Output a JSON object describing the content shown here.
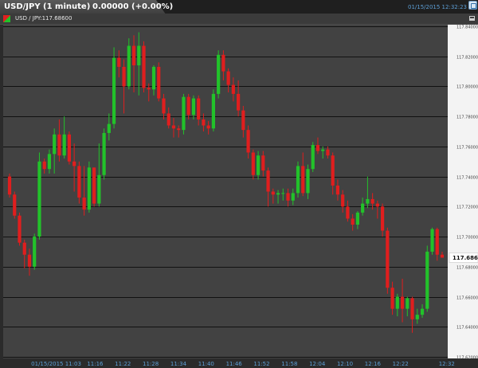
{
  "header": {
    "title": "USD/JPY (1 minute)",
    "change": "0.00000 (+0.00%)",
    "datetime": "01/15/2015 12:32:23"
  },
  "subheader": {
    "symbol_label": "USD / JPY:117.68600"
  },
  "colors": {
    "up": "#22c22a",
    "down": "#e01e1e",
    "background": "#424242",
    "grid": "#111111",
    "axis_text": "#5d9fd6"
  },
  "chart_data": {
    "type": "candlestick",
    "y_ticks": [
      "117.84000",
      "117.82000",
      "117.80000",
      "117.78000",
      "117.76000",
      "117.74000",
      "117.72000",
      "117.70000",
      "117.68000",
      "117.66000",
      "117.64000",
      "117.62000"
    ],
    "ylim": [
      117.62,
      117.84
    ],
    "x_ticks": [
      {
        "label": "01/15/2015 11:03",
        "x": 11.05
      },
      {
        "label": "11:16",
        "x": 11.2667
      },
      {
        "label": "11:22",
        "x": 11.3667
      },
      {
        "label": "11:28",
        "x": 11.4667
      },
      {
        "label": "11:34",
        "x": 11.5667
      },
      {
        "label": "11:40",
        "x": 11.6667
      },
      {
        "label": "11:46",
        "x": 11.7667
      },
      {
        "label": "11:52",
        "x": 11.8667
      },
      {
        "label": "11:58",
        "x": 11.9667
      },
      {
        "label": "12:04",
        "x": 12.0667
      },
      {
        "label": "12:10",
        "x": 12.1667
      },
      {
        "label": "12:16",
        "x": 12.2667
      },
      {
        "label": "12:22",
        "x": 12.3667
      },
      {
        "label": "12:32",
        "x": 12.5333
      }
    ],
    "last_price": "117.68600",
    "grid": true,
    "candles": [
      {
        "o": 117.74,
        "h": 117.742,
        "l": 117.726,
        "c": 117.728
      },
      {
        "o": 117.728,
        "h": 117.73,
        "l": 117.712,
        "c": 117.714
      },
      {
        "o": 117.714,
        "h": 117.716,
        "l": 117.694,
        "c": 117.696
      },
      {
        "o": 117.696,
        "h": 117.698,
        "l": 117.679,
        "c": 117.688
      },
      {
        "o": 117.688,
        "h": 117.692,
        "l": 117.674,
        "c": 117.68
      },
      {
        "o": 117.68,
        "h": 117.702,
        "l": 117.678,
        "c": 117.7
      },
      {
        "o": 117.7,
        "h": 117.756,
        "l": 117.698,
        "c": 117.75
      },
      {
        "o": 117.75,
        "h": 117.752,
        "l": 117.742,
        "c": 117.745
      },
      {
        "o": 117.745,
        "h": 117.758,
        "l": 117.742,
        "c": 117.755
      },
      {
        "o": 117.755,
        "h": 117.772,
        "l": 117.742,
        "c": 117.768
      },
      {
        "o": 117.768,
        "h": 117.778,
        "l": 117.75,
        "c": 117.754
      },
      {
        "o": 117.754,
        "h": 117.78,
        "l": 117.752,
        "c": 117.768
      },
      {
        "o": 117.768,
        "h": 117.77,
        "l": 117.748,
        "c": 117.75
      },
      {
        "o": 117.75,
        "h": 117.762,
        "l": 117.73,
        "c": 117.747
      },
      {
        "o": 117.747,
        "h": 117.75,
        "l": 117.722,
        "c": 117.726
      },
      {
        "o": 117.726,
        "h": 117.747,
        "l": 117.714,
        "c": 117.718
      },
      {
        "o": 117.718,
        "h": 117.75,
        "l": 117.716,
        "c": 117.746
      },
      {
        "o": 117.746,
        "h": 117.746,
        "l": 117.72,
        "c": 117.722
      },
      {
        "o": 117.722,
        "h": 117.762,
        "l": 117.72,
        "c": 117.741
      },
      {
        "o": 117.741,
        "h": 117.772,
        "l": 117.738,
        "c": 117.769
      },
      {
        "o": 117.769,
        "h": 117.782,
        "l": 117.764,
        "c": 117.775
      },
      {
        "o": 117.775,
        "h": 117.826,
        "l": 117.772,
        "c": 117.819
      },
      {
        "o": 117.819,
        "h": 117.824,
        "l": 117.806,
        "c": 117.813
      },
      {
        "o": 117.813,
        "h": 117.818,
        "l": 117.782,
        "c": 117.8
      },
      {
        "o": 117.8,
        "h": 117.832,
        "l": 117.798,
        "c": 117.827
      },
      {
        "o": 117.827,
        "h": 117.834,
        "l": 117.796,
        "c": 117.814
      },
      {
        "o": 117.814,
        "h": 117.836,
        "l": 117.794,
        "c": 117.827
      },
      {
        "o": 117.827,
        "h": 117.83,
        "l": 117.796,
        "c": 117.799
      },
      {
        "o": 117.799,
        "h": 117.802,
        "l": 117.79,
        "c": 117.798
      },
      {
        "o": 117.798,
        "h": 117.814,
        "l": 117.794,
        "c": 117.813
      },
      {
        "o": 117.813,
        "h": 117.816,
        "l": 117.79,
        "c": 117.792
      },
      {
        "o": 117.792,
        "h": 117.795,
        "l": 117.778,
        "c": 117.782
      },
      {
        "o": 117.782,
        "h": 117.786,
        "l": 117.772,
        "c": 117.774
      },
      {
        "o": 117.774,
        "h": 117.779,
        "l": 117.766,
        "c": 117.772
      },
      {
        "o": 117.772,
        "h": 117.774,
        "l": 117.766,
        "c": 117.771
      },
      {
        "o": 117.771,
        "h": 117.795,
        "l": 117.768,
        "c": 117.793
      },
      {
        "o": 117.793,
        "h": 117.795,
        "l": 117.778,
        "c": 117.781
      },
      {
        "o": 117.781,
        "h": 117.794,
        "l": 117.778,
        "c": 117.792
      },
      {
        "o": 117.792,
        "h": 117.794,
        "l": 117.774,
        "c": 117.778
      },
      {
        "o": 117.778,
        "h": 117.782,
        "l": 117.77,
        "c": 117.774
      },
      {
        "o": 117.774,
        "h": 117.777,
        "l": 117.768,
        "c": 117.772
      },
      {
        "o": 117.772,
        "h": 117.798,
        "l": 117.77,
        "c": 117.795
      },
      {
        "o": 117.795,
        "h": 117.824,
        "l": 117.792,
        "c": 117.821
      },
      {
        "o": 117.821,
        "h": 117.824,
        "l": 117.804,
        "c": 117.81
      },
      {
        "o": 117.81,
        "h": 117.812,
        "l": 117.796,
        "c": 117.801
      },
      {
        "o": 117.801,
        "h": 117.806,
        "l": 117.79,
        "c": 117.795
      },
      {
        "o": 117.795,
        "h": 117.804,
        "l": 117.78,
        "c": 117.784
      },
      {
        "o": 117.784,
        "h": 117.787,
        "l": 117.766,
        "c": 117.771
      },
      {
        "o": 117.771,
        "h": 117.774,
        "l": 117.752,
        "c": 117.756
      },
      {
        "o": 117.756,
        "h": 117.758,
        "l": 117.738,
        "c": 117.741
      },
      {
        "o": 117.741,
        "h": 117.757,
        "l": 117.738,
        "c": 117.754
      },
      {
        "o": 117.754,
        "h": 117.757,
        "l": 117.74,
        "c": 117.744
      },
      {
        "o": 117.744,
        "h": 117.746,
        "l": 117.72,
        "c": 117.73
      },
      {
        "o": 117.73,
        "h": 117.732,
        "l": 117.722,
        "c": 117.728
      },
      {
        "o": 117.728,
        "h": 117.731,
        "l": 117.722,
        "c": 117.729
      },
      {
        "o": 117.729,
        "h": 117.732,
        "l": 117.724,
        "c": 117.729
      },
      {
        "o": 117.729,
        "h": 117.732,
        "l": 117.72,
        "c": 117.724
      },
      {
        "o": 117.724,
        "h": 117.732,
        "l": 117.721,
        "c": 117.729
      },
      {
        "o": 117.729,
        "h": 117.75,
        "l": 117.726,
        "c": 117.747
      },
      {
        "o": 117.747,
        "h": 117.756,
        "l": 117.727,
        "c": 117.729
      },
      {
        "o": 117.729,
        "h": 117.748,
        "l": 117.725,
        "c": 117.745
      },
      {
        "o": 117.745,
        "h": 117.763,
        "l": 117.743,
        "c": 117.761
      },
      {
        "o": 117.761,
        "h": 117.766,
        "l": 117.755,
        "c": 117.757
      },
      {
        "o": 117.757,
        "h": 117.76,
        "l": 117.752,
        "c": 117.758
      },
      {
        "o": 117.758,
        "h": 117.76,
        "l": 117.752,
        "c": 117.754
      },
      {
        "o": 117.754,
        "h": 117.756,
        "l": 117.728,
        "c": 117.734
      },
      {
        "o": 117.734,
        "h": 117.738,
        "l": 117.724,
        "c": 117.728
      },
      {
        "o": 117.728,
        "h": 117.731,
        "l": 117.716,
        "c": 117.72
      },
      {
        "o": 117.72,
        "h": 117.724,
        "l": 117.71,
        "c": 117.712
      },
      {
        "o": 117.712,
        "h": 117.715,
        "l": 117.704,
        "c": 117.708
      },
      {
        "o": 117.708,
        "h": 117.717,
        "l": 117.705,
        "c": 117.716
      },
      {
        "o": 117.716,
        "h": 117.726,
        "l": 117.714,
        "c": 117.722
      },
      {
        "o": 117.722,
        "h": 117.74,
        "l": 117.719,
        "c": 117.725
      },
      {
        "o": 117.725,
        "h": 117.729,
        "l": 117.718,
        "c": 117.722
      },
      {
        "o": 117.722,
        "h": 117.724,
        "l": 117.712,
        "c": 117.72
      },
      {
        "o": 117.72,
        "h": 117.722,
        "l": 117.7,
        "c": 117.704
      },
      {
        "o": 117.704,
        "h": 117.706,
        "l": 117.662,
        "c": 117.666
      },
      {
        "o": 117.666,
        "h": 117.67,
        "l": 117.648,
        "c": 117.652
      },
      {
        "o": 117.652,
        "h": 117.662,
        "l": 117.647,
        "c": 117.66
      },
      {
        "o": 117.66,
        "h": 117.672,
        "l": 117.643,
        "c": 117.652
      },
      {
        "o": 117.652,
        "h": 117.66,
        "l": 117.647,
        "c": 117.659
      },
      {
        "o": 117.659,
        "h": 117.66,
        "l": 117.636,
        "c": 117.645
      },
      {
        "o": 117.645,
        "h": 117.652,
        "l": 117.642,
        "c": 117.648
      },
      {
        "o": 117.648,
        "h": 117.655,
        "l": 117.646,
        "c": 117.652
      },
      {
        "o": 117.652,
        "h": 117.694,
        "l": 117.65,
        "c": 117.69
      },
      {
        "o": 117.69,
        "h": 117.706,
        "l": 117.688,
        "c": 117.705
      },
      {
        "o": 117.705,
        "h": 117.706,
        "l": 117.684,
        "c": 117.688
      },
      {
        "o": 117.688,
        "h": 117.69,
        "l": 117.686,
        "c": 117.686
      }
    ]
  }
}
